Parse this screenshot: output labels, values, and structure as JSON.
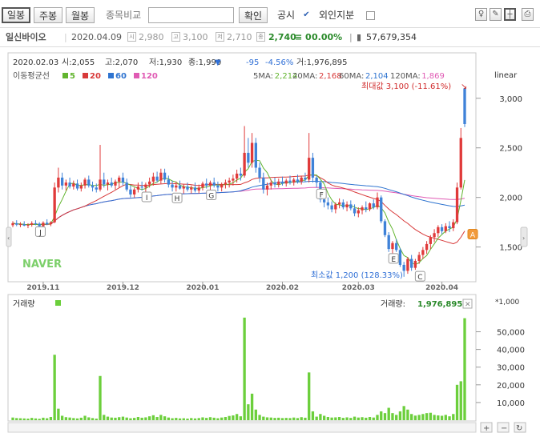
{
  "toolbar": {
    "day": "일봉",
    "week": "주봉",
    "month": "월봉",
    "compare_label": "종목비교",
    "compare_placeholder": "",
    "confirm": "확인",
    "disclosure": "공시",
    "disclosure_checked": true,
    "foreign": "외인지분",
    "foreign_checked": false
  },
  "infobar": {
    "name": "일신바이오",
    "date": "2020.04.09",
    "open_icon": "시",
    "open": "2,980",
    "high_icon": "고",
    "high": "3,100",
    "low_icon": "저",
    "low": "2,710",
    "close_icon": "종",
    "close": "2,740",
    "change": "≡ 0",
    "change_rate": "0.00%",
    "volume": "57,679,354"
  },
  "price_header": {
    "date": "2020.02.03",
    "open": "시:2,055",
    "high": "고:2,070",
    "low": "저:1,930",
    "close": "종:1,990",
    "down_mark": "▼",
    "diff": "-95",
    "rate": "-4.56%",
    "volume": "거:1,976,895"
  },
  "colors": {
    "up": "#e03a3a",
    "down": "#3f82d8",
    "ma5": "#62b52f",
    "ma20": "#d83a3a",
    "ma60": "#2f74d0",
    "ma120": "#e05bb4",
    "volume": "#6ccf3c"
  },
  "chart_data": {
    "type": "candlestick",
    "scale": "linear",
    "price_axis": {
      "ticks": [
        "3,000",
        "2,500",
        "2,000",
        "1,500"
      ],
      "ylim": [
        1150,
        3200
      ]
    },
    "volume_axis": {
      "multiplier": "*1,000",
      "ticks": [
        "50,000",
        "40,000",
        "30,000",
        "20,000",
        "10,000"
      ],
      "ylim": [
        0,
        62000
      ]
    },
    "x_labels": [
      "2019.11",
      "2019.12",
      "2020.01",
      "2020.02",
      "2020.03",
      "2020.04"
    ],
    "legend": {
      "title": "이동평균선",
      "items": [
        {
          "period": "5",
          "color": "#62b52f"
        },
        {
          "period": "20",
          "color": "#d83a3a"
        },
        {
          "period": "60",
          "color": "#2f74d0"
        },
        {
          "period": "120",
          "color": "#e05bb4"
        }
      ]
    },
    "ma_values": [
      {
        "label": "5MA:",
        "value": "2,214",
        "color": "#62b52f"
      },
      {
        "label": "20MA:",
        "value": "2,168",
        "color": "#d83a3a"
      },
      {
        "label": "60MA:",
        "value": "2,104",
        "color": "#2f74d0"
      },
      {
        "label": "120MA:",
        "value": "1,869",
        "color": "#e05bb4"
      }
    ],
    "max_label": "최대값 3,100 (-11.61%)",
    "min_label": "최소값 1,200 (128.33%)",
    "max_value": 3100,
    "min_value": 1200,
    "pattern_labels": [
      "J",
      "I",
      "H",
      "G",
      "F",
      "E",
      "C",
      "A"
    ],
    "watermark": "NAVER",
    "volume_title": "거래량",
    "volume_value_label": "거래량:",
    "volume_value": "1,976,895",
    "candles": [
      {
        "o": 1720,
        "h": 1760,
        "l": 1700,
        "c": 1740
      },
      {
        "o": 1740,
        "h": 1770,
        "l": 1710,
        "c": 1725
      },
      {
        "o": 1725,
        "h": 1750,
        "l": 1700,
        "c": 1730
      },
      {
        "o": 1730,
        "h": 1760,
        "l": 1710,
        "c": 1715
      },
      {
        "o": 1715,
        "h": 1740,
        "l": 1690,
        "c": 1725
      },
      {
        "o": 1725,
        "h": 1760,
        "l": 1705,
        "c": 1740
      },
      {
        "o": 1740,
        "h": 1770,
        "l": 1720,
        "c": 1735
      },
      {
        "o": 1735,
        "h": 1750,
        "l": 1700,
        "c": 1710
      },
      {
        "o": 1710,
        "h": 1760,
        "l": 1700,
        "c": 1745
      },
      {
        "o": 1745,
        "h": 1780,
        "l": 1720,
        "c": 1730
      },
      {
        "o": 1730,
        "h": 1760,
        "l": 1710,
        "c": 1750
      },
      {
        "o": 1750,
        "h": 2150,
        "l": 1740,
        "c": 2100
      },
      {
        "o": 2100,
        "h": 2300,
        "l": 2050,
        "c": 2200
      },
      {
        "o": 2200,
        "h": 2250,
        "l": 2080,
        "c": 2120
      },
      {
        "o": 2120,
        "h": 2180,
        "l": 2070,
        "c": 2150
      },
      {
        "o": 2150,
        "h": 2200,
        "l": 2090,
        "c": 2110
      },
      {
        "o": 2110,
        "h": 2170,
        "l": 2080,
        "c": 2140
      },
      {
        "o": 2140,
        "h": 2180,
        "l": 2070,
        "c": 2090
      },
      {
        "o": 2090,
        "h": 2150,
        "l": 2060,
        "c": 2120
      },
      {
        "o": 2120,
        "h": 2200,
        "l": 2090,
        "c": 2180
      },
      {
        "o": 2180,
        "h": 2220,
        "l": 2100,
        "c": 2120
      },
      {
        "o": 2120,
        "h": 2160,
        "l": 2060,
        "c": 2100
      },
      {
        "o": 2100,
        "h": 2140,
        "l": 2050,
        "c": 2080
      },
      {
        "o": 2080,
        "h": 2530,
        "l": 2060,
        "c": 2180
      },
      {
        "o": 2180,
        "h": 2250,
        "l": 2100,
        "c": 2130
      },
      {
        "o": 2130,
        "h": 2180,
        "l": 2070,
        "c": 2150
      },
      {
        "o": 2150,
        "h": 2200,
        "l": 2100,
        "c": 2120
      },
      {
        "o": 2120,
        "h": 2180,
        "l": 2080,
        "c": 2160
      },
      {
        "o": 2160,
        "h": 2220,
        "l": 2100,
        "c": 2200
      },
      {
        "o": 2200,
        "h": 2250,
        "l": 2120,
        "c": 2150
      },
      {
        "o": 2150,
        "h": 2190,
        "l": 2060,
        "c": 2080
      },
      {
        "o": 2080,
        "h": 2120,
        "l": 2000,
        "c": 2030
      },
      {
        "o": 2030,
        "h": 2100,
        "l": 2000,
        "c": 2080
      },
      {
        "o": 2080,
        "h": 2150,
        "l": 2050,
        "c": 2110
      },
      {
        "o": 2110,
        "h": 2160,
        "l": 2070,
        "c": 2100
      },
      {
        "o": 2100,
        "h": 2150,
        "l": 2050,
        "c": 2130
      },
      {
        "o": 2130,
        "h": 2200,
        "l": 2100,
        "c": 2160
      },
      {
        "o": 2160,
        "h": 2250,
        "l": 2120,
        "c": 2210
      },
      {
        "o": 2210,
        "h": 2260,
        "l": 2150,
        "c": 2170
      },
      {
        "o": 2170,
        "h": 2290,
        "l": 2140,
        "c": 2250
      },
      {
        "o": 2250,
        "h": 2290,
        "l": 2150,
        "c": 2180
      },
      {
        "o": 2180,
        "h": 2220,
        "l": 2100,
        "c": 2130
      },
      {
        "o": 2130,
        "h": 2170,
        "l": 2060,
        "c": 2100
      },
      {
        "o": 2100,
        "h": 2160,
        "l": 2060,
        "c": 2120
      },
      {
        "o": 2120,
        "h": 2170,
        "l": 2080,
        "c": 2090
      },
      {
        "o": 2090,
        "h": 2130,
        "l": 2040,
        "c": 2110
      },
      {
        "o": 2110,
        "h": 2150,
        "l": 2060,
        "c": 2080
      },
      {
        "o": 2080,
        "h": 2120,
        "l": 2040,
        "c": 2100
      },
      {
        "o": 2100,
        "h": 2150,
        "l": 2050,
        "c": 2070
      },
      {
        "o": 2070,
        "h": 2130,
        "l": 2040,
        "c": 2100
      },
      {
        "o": 2100,
        "h": 2160,
        "l": 2070,
        "c": 2140
      },
      {
        "o": 2140,
        "h": 2190,
        "l": 2090,
        "c": 2120
      },
      {
        "o": 2120,
        "h": 2170,
        "l": 2070,
        "c": 2150
      },
      {
        "o": 2150,
        "h": 2200,
        "l": 2100,
        "c": 2120
      },
      {
        "o": 2120,
        "h": 2160,
        "l": 2060,
        "c": 2100
      },
      {
        "o": 2100,
        "h": 2150,
        "l": 2060,
        "c": 2130
      },
      {
        "o": 2130,
        "h": 2180,
        "l": 2090,
        "c": 2150
      },
      {
        "o": 2150,
        "h": 2200,
        "l": 2100,
        "c": 2170
      },
      {
        "o": 2170,
        "h": 2230,
        "l": 2120,
        "c": 2190
      },
      {
        "o": 2190,
        "h": 2280,
        "l": 2150,
        "c": 2240
      },
      {
        "o": 2240,
        "h": 2300,
        "l": 2170,
        "c": 2220
      },
      {
        "o": 2220,
        "h": 2720,
        "l": 2200,
        "c": 2450
      },
      {
        "o": 2450,
        "h": 2600,
        "l": 2300,
        "c": 2350
      },
      {
        "o": 2350,
        "h": 2650,
        "l": 2300,
        "c": 2550
      },
      {
        "o": 2550,
        "h": 2600,
        "l": 2250,
        "c": 2300
      },
      {
        "o": 2300,
        "h": 2350,
        "l": 2150,
        "c": 2200
      },
      {
        "o": 2200,
        "h": 2250,
        "l": 2040,
        "c": 2080
      },
      {
        "o": 2080,
        "h": 2150,
        "l": 2020,
        "c": 2120
      },
      {
        "o": 2120,
        "h": 2180,
        "l": 2080,
        "c": 2150
      },
      {
        "o": 2150,
        "h": 2200,
        "l": 2100,
        "c": 2130
      },
      {
        "o": 2130,
        "h": 2190,
        "l": 2100,
        "c": 2160
      },
      {
        "o": 2160,
        "h": 2210,
        "l": 2120,
        "c": 2140
      },
      {
        "o": 2140,
        "h": 2190,
        "l": 2110,
        "c": 2170
      },
      {
        "o": 2170,
        "h": 2220,
        "l": 2130,
        "c": 2150
      },
      {
        "o": 2150,
        "h": 2200,
        "l": 2120,
        "c": 2180
      },
      {
        "o": 2180,
        "h": 2230,
        "l": 2140,
        "c": 2160
      },
      {
        "o": 2160,
        "h": 2220,
        "l": 2130,
        "c": 2200
      },
      {
        "o": 2200,
        "h": 2250,
        "l": 2160,
        "c": 2180
      },
      {
        "o": 2180,
        "h": 2650,
        "l": 2150,
        "c": 2400
      },
      {
        "o": 2400,
        "h": 2450,
        "l": 2150,
        "c": 2200
      },
      {
        "o": 2200,
        "h": 2220,
        "l": 2100,
        "c": 2150
      },
      {
        "o": 2150,
        "h": 2170,
        "l": 1950,
        "c": 1980
      },
      {
        "o": 1980,
        "h": 2050,
        "l": 1900,
        "c": 1950
      },
      {
        "o": 1950,
        "h": 2000,
        "l": 1880,
        "c": 1920
      },
      {
        "o": 1920,
        "h": 1960,
        "l": 1850,
        "c": 1880
      },
      {
        "o": 1880,
        "h": 1950,
        "l": 1840,
        "c": 1930
      },
      {
        "o": 1930,
        "h": 1990,
        "l": 1890,
        "c": 1950
      },
      {
        "o": 1950,
        "h": 1980,
        "l": 1880,
        "c": 1900
      },
      {
        "o": 1900,
        "h": 1960,
        "l": 1860,
        "c": 1930
      },
      {
        "o": 1930,
        "h": 1970,
        "l": 1870,
        "c": 1890
      },
      {
        "o": 1890,
        "h": 1930,
        "l": 1810,
        "c": 1840
      },
      {
        "o": 1840,
        "h": 1900,
        "l": 1800,
        "c": 1870
      },
      {
        "o": 1870,
        "h": 1920,
        "l": 1830,
        "c": 1900
      },
      {
        "o": 1900,
        "h": 1960,
        "l": 1850,
        "c": 1880
      },
      {
        "o": 1880,
        "h": 1950,
        "l": 1860,
        "c": 1940
      },
      {
        "o": 1940,
        "h": 1980,
        "l": 1880,
        "c": 1900
      },
      {
        "o": 1900,
        "h": 2050,
        "l": 1880,
        "c": 2000
      },
      {
        "o": 2000,
        "h": 2020,
        "l": 1740,
        "c": 1760
      },
      {
        "o": 1760,
        "h": 1780,
        "l": 1600,
        "c": 1620
      },
      {
        "o": 1620,
        "h": 1650,
        "l": 1450,
        "c": 1480
      },
      {
        "o": 1480,
        "h": 1560,
        "l": 1420,
        "c": 1540
      },
      {
        "o": 1540,
        "h": 1580,
        "l": 1450,
        "c": 1470
      },
      {
        "o": 1470,
        "h": 1490,
        "l": 1300,
        "c": 1320
      },
      {
        "o": 1320,
        "h": 1350,
        "l": 1200,
        "c": 1260
      },
      {
        "o": 1260,
        "h": 1400,
        "l": 1230,
        "c": 1380
      },
      {
        "o": 1380,
        "h": 1420,
        "l": 1260,
        "c": 1290
      },
      {
        "o": 1290,
        "h": 1380,
        "l": 1270,
        "c": 1360
      },
      {
        "o": 1360,
        "h": 1450,
        "l": 1330,
        "c": 1420
      },
      {
        "o": 1420,
        "h": 1500,
        "l": 1380,
        "c": 1470
      },
      {
        "o": 1470,
        "h": 1560,
        "l": 1430,
        "c": 1530
      },
      {
        "o": 1530,
        "h": 1620,
        "l": 1480,
        "c": 1600
      },
      {
        "o": 1600,
        "h": 1680,
        "l": 1550,
        "c": 1640
      },
      {
        "o": 1640,
        "h": 1720,
        "l": 1600,
        "c": 1700
      },
      {
        "o": 1700,
        "h": 1730,
        "l": 1630,
        "c": 1660
      },
      {
        "o": 1660,
        "h": 1740,
        "l": 1640,
        "c": 1710
      },
      {
        "o": 1710,
        "h": 1760,
        "l": 1650,
        "c": 1690
      },
      {
        "o": 1690,
        "h": 1780,
        "l": 1660,
        "c": 1750
      },
      {
        "o": 1750,
        "h": 2150,
        "l": 1730,
        "c": 2100
      },
      {
        "o": 2100,
        "h": 2700,
        "l": 2080,
        "c": 2600
      },
      {
        "o": 3100,
        "h": 3100,
        "l": 2710,
        "c": 2740
      }
    ],
    "volume": [
      1500,
      1200,
      1100,
      1000,
      900,
      1300,
      1000,
      800,
      1400,
      1100,
      1800,
      37000,
      6500,
      2500,
      1700,
      1500,
      1200,
      1000,
      1400,
      2500,
      1600,
      1200,
      900,
      25000,
      3000,
      2000,
      1500,
      1400,
      1700,
      2000,
      1500,
      1100,
      1300,
      1800,
      1400,
      1600,
      2200,
      2800,
      1800,
      3000,
      2200,
      1500,
      1100,
      1300,
      1000,
      1100,
      900,
      1200,
      1000,
      1200,
      1600,
      1300,
      1700,
      1400,
      1100,
      1500,
      1800,
      2400,
      2700,
      3500,
      2200,
      58000,
      9000,
      15000,
      6000,
      3000,
      2000,
      1600,
      1500,
      1300,
      1400,
      1200,
      1300,
      1200,
      1500,
      1200,
      1700,
      1400,
      27000,
      5000,
      2000,
      3500,
      2500,
      1800,
      1500,
      1600,
      1800,
      1300,
      1600,
      1300,
      2000,
      1500,
      1700,
      1400,
      1800,
      1500,
      3000,
      5000,
      4000,
      7000,
      4000,
      3000,
      5000,
      8000,
      6000,
      3500,
      2600,
      3000,
      3500,
      4000,
      4200,
      3000,
      2700,
      2500,
      3000,
      2200,
      3500,
      20000,
      22000,
      57679
    ]
  }
}
